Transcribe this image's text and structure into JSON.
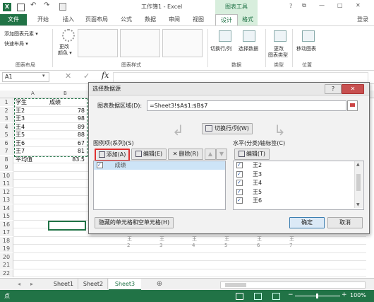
{
  "titlebar": {
    "title": "工作簿1 - Excel",
    "context_group": "图表工具",
    "user": "登录",
    "help": "?",
    "restore": "⧉",
    "minimize": "—",
    "maximize": "□",
    "close": "✕"
  },
  "tabs": {
    "file": "文件",
    "home": "开始",
    "insert": "插入",
    "layout": "页面布局",
    "formulas": "公式",
    "data": "数据",
    "review": "审阅",
    "view": "视图",
    "design": "设计",
    "format": "格式"
  },
  "ribbon": {
    "add_element": "添加图表元素 ▾",
    "quick_layout": "快速布局 ▾",
    "change_color": "更改",
    "change_color2": "颜色 ▾",
    "group_layouts": "图表布局",
    "group_styles": "图表样式",
    "switch_rowcol": "切换行/列",
    "select_data": "选择数据",
    "group_data": "数据",
    "change_type": "更改",
    "change_type2": "图表类型",
    "group_type": "类型",
    "move_chart": "移动图表",
    "group_location": "位置"
  },
  "formula_bar": {
    "namebox": "A1",
    "cancel": "✕",
    "enter": "✓",
    "fx": "fx"
  },
  "sheet": {
    "columns": [
      "A",
      "B"
    ],
    "rows": [
      "1",
      "2",
      "3",
      "4",
      "5",
      "6",
      "7",
      "8",
      "9",
      "10",
      "11",
      "12",
      "13",
      "14",
      "15",
      "16",
      "17",
      "18",
      "19",
      "20",
      "21",
      "22"
    ],
    "data": [
      {
        "a": "学生",
        "b": "成绩"
      },
      {
        "a": "王2",
        "b": "78"
      },
      {
        "a": "王3",
        "b": "98"
      },
      {
        "a": "王4",
        "b": "89"
      },
      {
        "a": "王5",
        "b": "88"
      },
      {
        "a": "王6",
        "b": "67"
      },
      {
        "a": "王7",
        "b": "81"
      },
      {
        "a": "平均值",
        "b": "83.5"
      }
    ],
    "chart_categories": [
      "王2",
      "王3",
      "王4",
      "王5",
      "王6",
      "王7"
    ]
  },
  "dialog": {
    "title": "选择数据源",
    "help": "?",
    "close": "✕",
    "range_label": "图表数据区域(D):",
    "range_value": "=Sheet3!$A$1:$B$7",
    "switch_label": "切换行/列(W)",
    "series_label": "图例项(系列)(S)",
    "add": "添加(A)",
    "edit": "编辑(E)",
    "delete": "删除(R)",
    "up": "▲",
    "down": "▼",
    "series": [
      "成绩"
    ],
    "axis_label": "水平(分类)轴标签(C)",
    "axis_edit": "编辑(T)",
    "axis_items": [
      "王2",
      "王3",
      "王4",
      "王5",
      "王6"
    ],
    "hidden_cells": "隐藏的单元格和空单元格(H)",
    "ok": "确定",
    "cancel": "取消"
  },
  "sheet_tabs": {
    "prev": "◂",
    "next": "▸",
    "tabs": [
      "Sheet1",
      "Sheet2",
      "Sheet3"
    ],
    "add": "⊕"
  },
  "status": {
    "mode": "点",
    "zoom": "100%",
    "minus": "−",
    "plus": "+"
  },
  "colors": {
    "excel_green": "#217346",
    "context_tab": "#d8eedd",
    "highlight_red": "#e03030",
    "selection_blue": "#cde4f7"
  }
}
